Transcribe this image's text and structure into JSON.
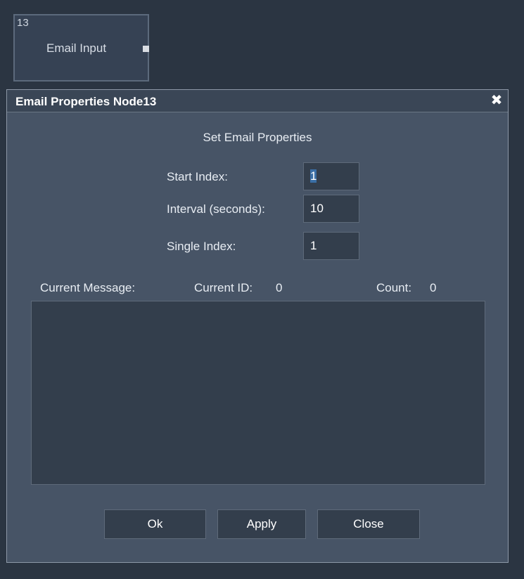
{
  "node": {
    "id_label": "13",
    "title": "Email Input",
    "port_icon": "square-port-icon"
  },
  "dialog": {
    "title": "Email Properties Node13",
    "close_glyph": "✖",
    "heading": "Set Email Properties",
    "fields": {
      "start_index": {
        "label": "Start Index:",
        "value": "1"
      },
      "interval": {
        "label": "Interval (seconds):",
        "value": "10"
      },
      "single_index": {
        "label": "Single Index:",
        "value": "1"
      }
    },
    "status": {
      "current_message_label": "Current Message:",
      "current_id_label": "Current ID:",
      "current_id_value": "0",
      "count_label": "Count:",
      "count_value": "0"
    },
    "message_text": "",
    "buttons": {
      "ok": "Ok",
      "apply": "Apply",
      "close": "Close"
    }
  },
  "colors": {
    "background": "#2b3542",
    "dialog": "#475466",
    "input": "#333e4c",
    "selection": "#3a6ea5"
  }
}
